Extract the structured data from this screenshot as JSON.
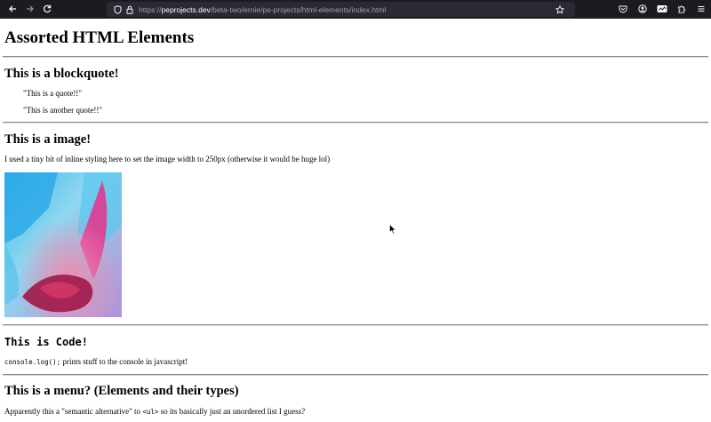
{
  "browser": {
    "url_prefix": "https://",
    "url_host": "peprojects.dev",
    "url_path": "/beta-two/ernie/pe-projects/html-elements/index.html"
  },
  "page": {
    "title": "Assorted HTML Elements",
    "blockquote": {
      "heading": "This is a blockquote!",
      "quote1": "\"This is a quote!!\"",
      "quote2": "\"This is another quote!!\""
    },
    "image": {
      "heading": "This is a image!",
      "description": "I used a tiny bit of inline styling here to set the image width to 250px (otherwise it would be huge lol)"
    },
    "code": {
      "heading": "This is Code!",
      "snippet": "console.log();",
      "description": " prints stuff to the console in javascript!"
    },
    "menu": {
      "heading": "This is a menu? (Elements and their types)",
      "desc_before": "Apparently this a \"semantic alternative\" to ",
      "desc_code": "<ul>",
      "desc_after": " so its basically just an unordered list I guess?"
    }
  },
  "colors": {
    "chrome_bg": "#1c1b22",
    "urlbar_bg": "#2b2a33"
  }
}
